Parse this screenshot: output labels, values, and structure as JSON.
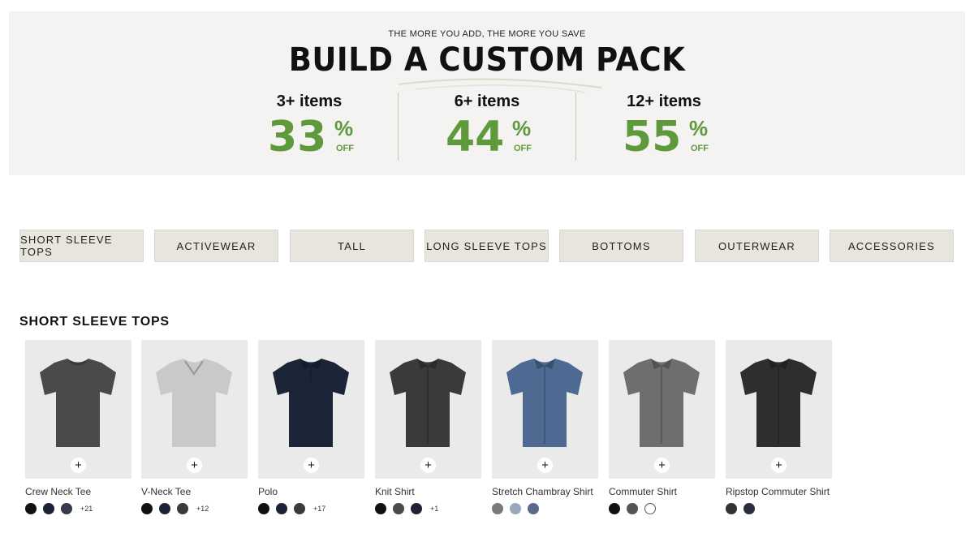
{
  "hero": {
    "eyebrow": "THE MORE YOU ADD, THE MORE YOU SAVE",
    "title": "BUILD A CUSTOM PACK",
    "tiers": [
      {
        "label": "3+ items",
        "value": "33",
        "pct": "%",
        "off": "OFF"
      },
      {
        "label": "6+ items",
        "value": "44",
        "pct": "%",
        "off": "OFF"
      },
      {
        "label": "12+ items",
        "value": "55",
        "pct": "%",
        "off": "OFF"
      }
    ],
    "accent_color": "#5e9a3c"
  },
  "categories": [
    "SHORT SLEEVE TOPS",
    "ACTIVEWEAR",
    "TALL",
    "LONG SLEEVE TOPS",
    "BOTTOMS",
    "OUTERWEAR",
    "ACCESSORIES"
  ],
  "section": {
    "title": "SHORT SLEEVE TOPS"
  },
  "products": [
    {
      "name": "Crew Neck Tee",
      "shirt_color": "#4a4a4c",
      "type": "tee",
      "add": "+",
      "more": "+21",
      "swatches": [
        "#111111",
        "#1e2236",
        "#353a4c"
      ]
    },
    {
      "name": "V-Neck Tee",
      "shirt_color": "#c9c9c9",
      "type": "vneck",
      "add": "+",
      "more": "+12",
      "swatches": [
        "#111111",
        "#1e2236",
        "#3a3a3c"
      ]
    },
    {
      "name": "Polo",
      "shirt_color": "#1c2438",
      "type": "polo",
      "add": "+",
      "more": "+17",
      "swatches": [
        "#111111",
        "#1e2236",
        "#3a3a3c"
      ]
    },
    {
      "name": "Knit Shirt",
      "shirt_color": "#3a3a3a",
      "type": "button",
      "add": "+",
      "more": "+1",
      "swatches": [
        "#111111",
        "#4a4a4c",
        "#1e2236"
      ]
    },
    {
      "name": "Stretch Chambray Shirt",
      "shirt_color": "#4e6a92",
      "type": "button",
      "add": "+",
      "more": "",
      "swatches": [
        "#7a7a7a",
        "#9aa8bc",
        "#5a6a88"
      ]
    },
    {
      "name": "Commuter Shirt",
      "shirt_color": "#6e6e6e",
      "type": "button",
      "add": "+",
      "more": "",
      "swatches": [
        "#111111",
        "#555555",
        "#ffffff"
      ]
    },
    {
      "name": "Ripstop Commuter Shirt",
      "shirt_color": "#2e2e2e",
      "type": "button",
      "add": "+",
      "more": "",
      "swatches": [
        "#333333",
        "#2a2e40"
      ]
    }
  ]
}
